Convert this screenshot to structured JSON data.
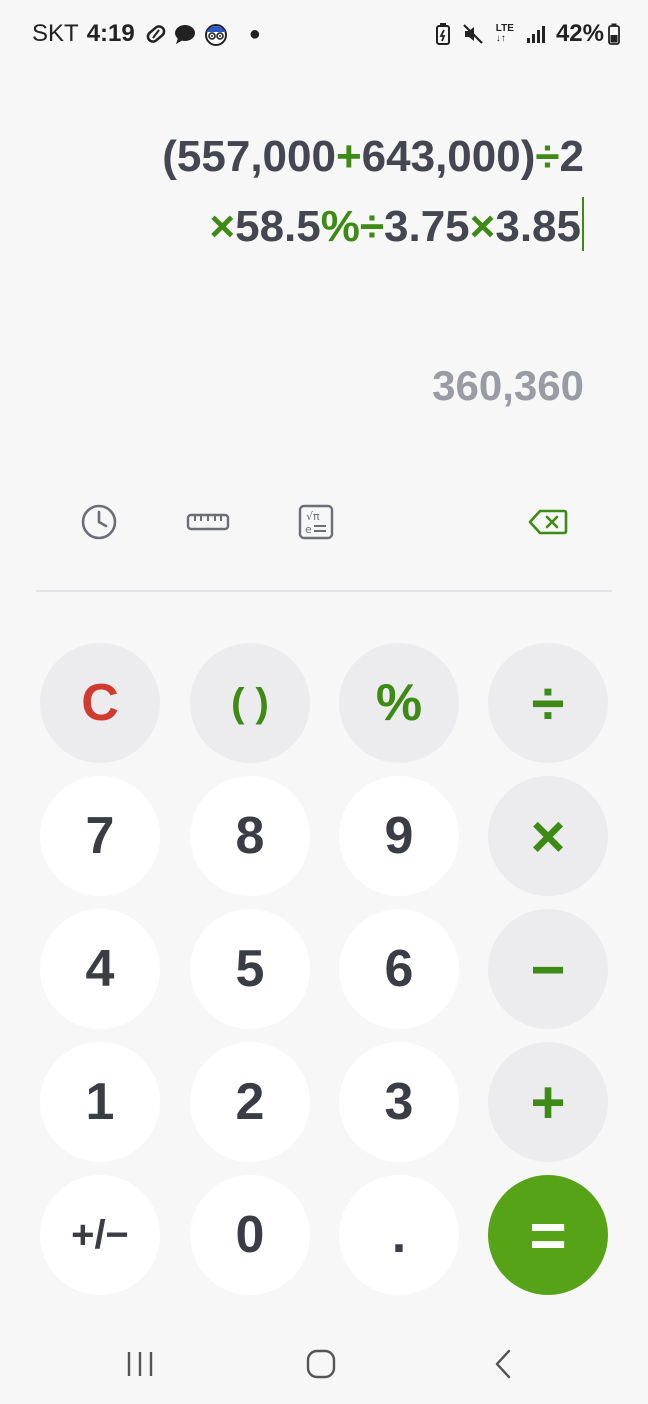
{
  "status_bar": {
    "carrier": "SKT",
    "time": "4:19",
    "battery": "42%",
    "network": "LTE",
    "icons_left": [
      "pill-icon",
      "chat-bubble-icon",
      "avatar-icon",
      "dot"
    ],
    "icons_right": [
      "battery-saver-icon",
      "mute-icon",
      "lte-icon",
      "signal-icon",
      "battery-icon"
    ]
  },
  "display": {
    "expression_line1": [
      {
        "t": "(557,000",
        "op": false
      },
      {
        "t": "+",
        "op": true
      },
      {
        "t": "643,000)",
        "op": false
      },
      {
        "t": "÷",
        "op": true
      },
      {
        "t": "2",
        "op": false
      }
    ],
    "expression_line2": [
      {
        "t": "×",
        "op": true
      },
      {
        "t": "58.5",
        "op": false
      },
      {
        "t": "%",
        "op": true
      },
      {
        "t": "÷",
        "op": true
      },
      {
        "t": "3.75",
        "op": false
      },
      {
        "t": "×",
        "op": true
      },
      {
        "t": "3.85",
        "op": false
      }
    ],
    "result": "360,360"
  },
  "toolbar": {
    "history_icon": "history-clock-icon",
    "unit_converter_icon": "ruler-icon",
    "scientific_icon": "scientific-mode-icon",
    "backspace_icon": "backspace-icon"
  },
  "keys": {
    "clear": "C",
    "parentheses": "( )",
    "percent": "%",
    "divide": "÷",
    "seven": "7",
    "eight": "8",
    "nine": "9",
    "multiply": "×",
    "four": "4",
    "five": "5",
    "six": "6",
    "minus": "−",
    "one": "1",
    "two": "2",
    "three": "3",
    "plus": "+",
    "plus_minus": "+/−",
    "zero": "0",
    "decimal": ".",
    "equals": "="
  },
  "colors": {
    "accent_green": "#3d8a15",
    "equals_green": "#56a317",
    "clear_red": "#d13a2e",
    "result_gray": "#9a9ca3"
  }
}
